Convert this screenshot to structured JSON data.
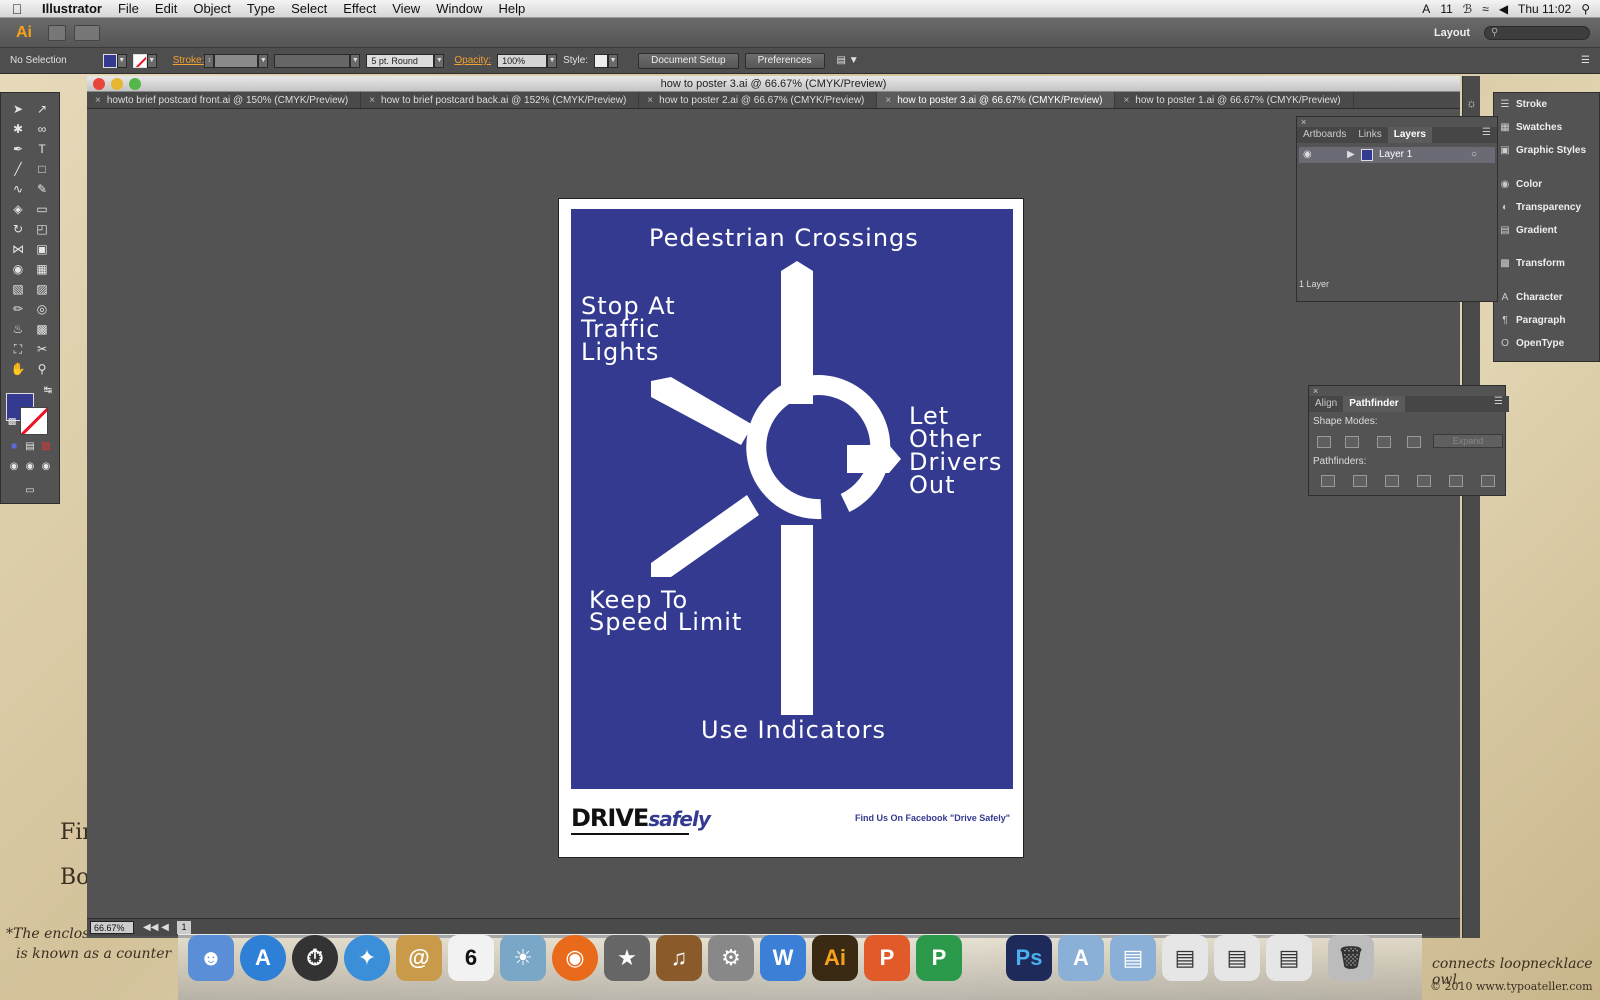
{
  "menubar": {
    "app_name": "Illustrator",
    "items": [
      "File",
      "Edit",
      "Object",
      "Type",
      "Select",
      "Effect",
      "View",
      "Window",
      "Help"
    ],
    "status_count": "11",
    "clock": "Thu 11:02"
  },
  "appbar": {
    "logo": "Ai",
    "workspace": "Layout"
  },
  "controlbar": {
    "selection": "No Selection",
    "stroke_label": "Stroke:",
    "brush": "5 pt. Round",
    "opacity_label": "Opacity:",
    "opacity_value": "100%",
    "style_label": "Style:",
    "document_setup": "Document Setup",
    "preferences": "Preferences"
  },
  "document": {
    "title": "how to poster 3.ai @ 66.67% (CMYK/Preview)",
    "tabs": [
      "howto brief postcard front.ai @ 150% (CMYK/Preview)",
      "how to brief postcard back.ai @ 152% (CMYK/Preview)",
      "how to poster 2.ai @ 66.67% (CMYK/Preview)",
      "how to poster 3.ai @ 66.67% (CMYK/Preview)",
      "how to poster 1.ai @ 66.67% (CMYK/Preview)"
    ],
    "zoom": "66.67%",
    "page": "1"
  },
  "poster": {
    "color": "#333a8f",
    "title": "Pedestrian Crossings",
    "stop": "Stop At\nTraffic\nLights",
    "let_other": "Let\nOther\nDrivers\nOut",
    "keep_to": "Keep To\nSpeed Limit",
    "indicators": "Use Indicators",
    "logo_drive": "DRIVE",
    "logo_safely": "safely",
    "facebook": "Find Us On Facebook \"Drive Safely\""
  },
  "panels": {
    "list": [
      "Stroke",
      "Swatches",
      "Graphic Styles",
      "Color",
      "Transparency",
      "Gradient",
      "Transform",
      "Character",
      "Paragraph",
      "OpenType"
    ],
    "layers": {
      "tabs": [
        "Artboards",
        "Links",
        "Layers"
      ],
      "layer_name": "Layer 1",
      "count": "1 Layer"
    },
    "pathfinder": {
      "tabs": [
        "Align",
        "Pathfinder"
      ],
      "shape_modes": "Shape Modes:",
      "pathfinders": "Pathfinders:",
      "expand": "Expand"
    }
  },
  "wallpaper": {
    "note1": "*The enclosed",
    "note2": "is known as a counter",
    "note3": "connects loopnecklace owl.",
    "copyright": "© 2010 www.typoateller.com",
    "fin": "Fini",
    "bov": "Bov"
  }
}
